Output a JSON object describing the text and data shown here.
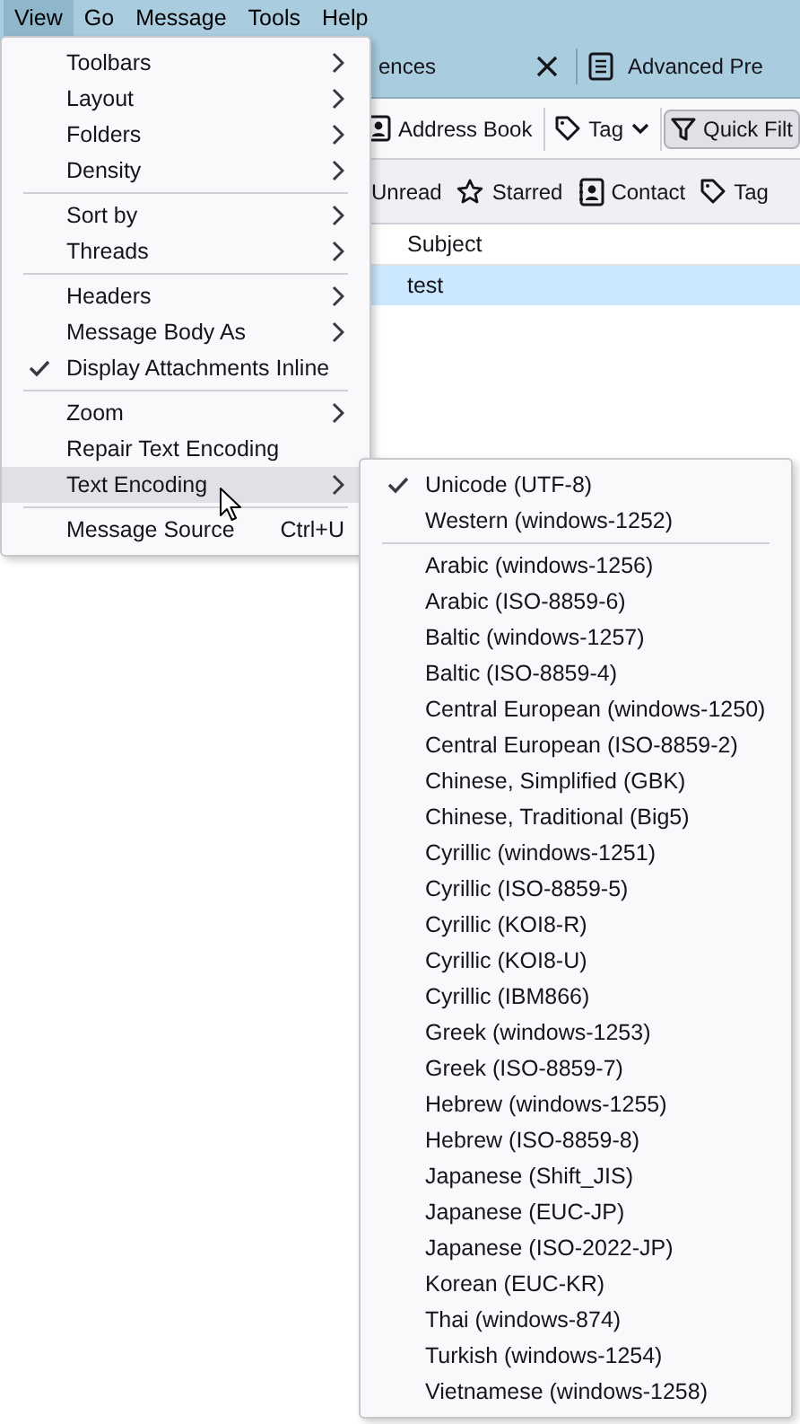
{
  "menubar": [
    {
      "label": "View",
      "selected": true
    },
    {
      "label": "Go",
      "selected": false
    },
    {
      "label": "Message",
      "selected": false
    },
    {
      "label": "Tools",
      "selected": false
    },
    {
      "label": "Help",
      "selected": false
    }
  ],
  "tabs": [
    {
      "label": "ences",
      "kind": "cut"
    },
    {
      "label": "Advanced Pre",
      "kind": "document"
    }
  ],
  "toolbar": [
    {
      "label": "Address Book",
      "kind": "address-book",
      "pressed": false
    },
    {
      "label": "Tag",
      "kind": "tag",
      "pressed": false
    },
    {
      "label": "Quick Filt",
      "kind": "filter",
      "pressed": true
    }
  ],
  "filter_bar": [
    {
      "label": "Unread",
      "kind": "none"
    },
    {
      "label": "Starred",
      "kind": "star"
    },
    {
      "label": "Contact",
      "kind": "contact"
    },
    {
      "label": "Tag",
      "kind": "tag"
    }
  ],
  "message_list": {
    "columns": [
      "Subject"
    ],
    "rows": [
      {
        "subject": "test",
        "selected": true
      }
    ]
  },
  "view_menu": [
    {
      "kind": "submenu",
      "label": "Toolbars",
      "selected": false
    },
    {
      "kind": "submenu",
      "label": "Layout",
      "selected": false
    },
    {
      "kind": "submenu",
      "label": "Folders",
      "selected": false
    },
    {
      "kind": "submenu",
      "label": "Density",
      "selected": false
    },
    {
      "kind": "separator"
    },
    {
      "kind": "submenu",
      "label": "Sort by",
      "selected": false
    },
    {
      "kind": "submenu",
      "label": "Threads",
      "selected": false
    },
    {
      "kind": "separator"
    },
    {
      "kind": "submenu",
      "label": "Headers",
      "selected": false
    },
    {
      "kind": "submenu",
      "label": "Message Body As",
      "selected": false
    },
    {
      "kind": "check",
      "label": "Display Attachments Inline",
      "checked": true,
      "selected": false
    },
    {
      "kind": "separator"
    },
    {
      "kind": "submenu",
      "label": "Zoom",
      "selected": false
    },
    {
      "kind": "plain",
      "label": "Repair Text Encoding",
      "selected": false
    },
    {
      "kind": "submenu",
      "label": "Text Encoding",
      "selected": true
    },
    {
      "kind": "separator"
    },
    {
      "kind": "plain",
      "label": "Message Source",
      "shortcut": "Ctrl+U",
      "selected": false
    }
  ],
  "encoding_menu": [
    {
      "kind": "check",
      "label": "Unicode (UTF-8)",
      "checked": true
    },
    {
      "kind": "check",
      "label": "Western (windows-1252)",
      "checked": false
    },
    {
      "kind": "separator"
    },
    {
      "kind": "check",
      "label": "Arabic (windows-1256)",
      "checked": false
    },
    {
      "kind": "check",
      "label": "Arabic (ISO-8859-6)",
      "checked": false
    },
    {
      "kind": "check",
      "label": "Baltic (windows-1257)",
      "checked": false
    },
    {
      "kind": "check",
      "label": "Baltic (ISO-8859-4)",
      "checked": false
    },
    {
      "kind": "check",
      "label": "Central European (windows-1250)",
      "checked": false
    },
    {
      "kind": "check",
      "label": "Central European (ISO-8859-2)",
      "checked": false
    },
    {
      "kind": "check",
      "label": "Chinese, Simplified (GBK)",
      "checked": false
    },
    {
      "kind": "check",
      "label": "Chinese, Traditional (Big5)",
      "checked": false
    },
    {
      "kind": "check",
      "label": "Cyrillic (windows-1251)",
      "checked": false
    },
    {
      "kind": "check",
      "label": "Cyrillic (ISO-8859-5)",
      "checked": false
    },
    {
      "kind": "check",
      "label": "Cyrillic (KOI8-R)",
      "checked": false
    },
    {
      "kind": "check",
      "label": "Cyrillic (KOI8-U)",
      "checked": false
    },
    {
      "kind": "check",
      "label": "Cyrillic (IBM866)",
      "checked": false
    },
    {
      "kind": "check",
      "label": "Greek (windows-1253)",
      "checked": false
    },
    {
      "kind": "check",
      "label": "Greek (ISO-8859-7)",
      "checked": false
    },
    {
      "kind": "check",
      "label": "Hebrew (windows-1255)",
      "checked": false
    },
    {
      "kind": "check",
      "label": "Hebrew (ISO-8859-8)",
      "checked": false
    },
    {
      "kind": "check",
      "label": "Japanese (Shift_JIS)",
      "checked": false
    },
    {
      "kind": "check",
      "label": "Japanese (EUC-JP)",
      "checked": false
    },
    {
      "kind": "check",
      "label": "Japanese (ISO-2022-JP)",
      "checked": false
    },
    {
      "kind": "check",
      "label": "Korean (EUC-KR)",
      "checked": false
    },
    {
      "kind": "check",
      "label": "Thai (windows-874)",
      "checked": false
    },
    {
      "kind": "check",
      "label": "Turkish (windows-1254)",
      "checked": false
    },
    {
      "kind": "check",
      "label": "Vietnamese (windows-1258)",
      "checked": false
    }
  ]
}
